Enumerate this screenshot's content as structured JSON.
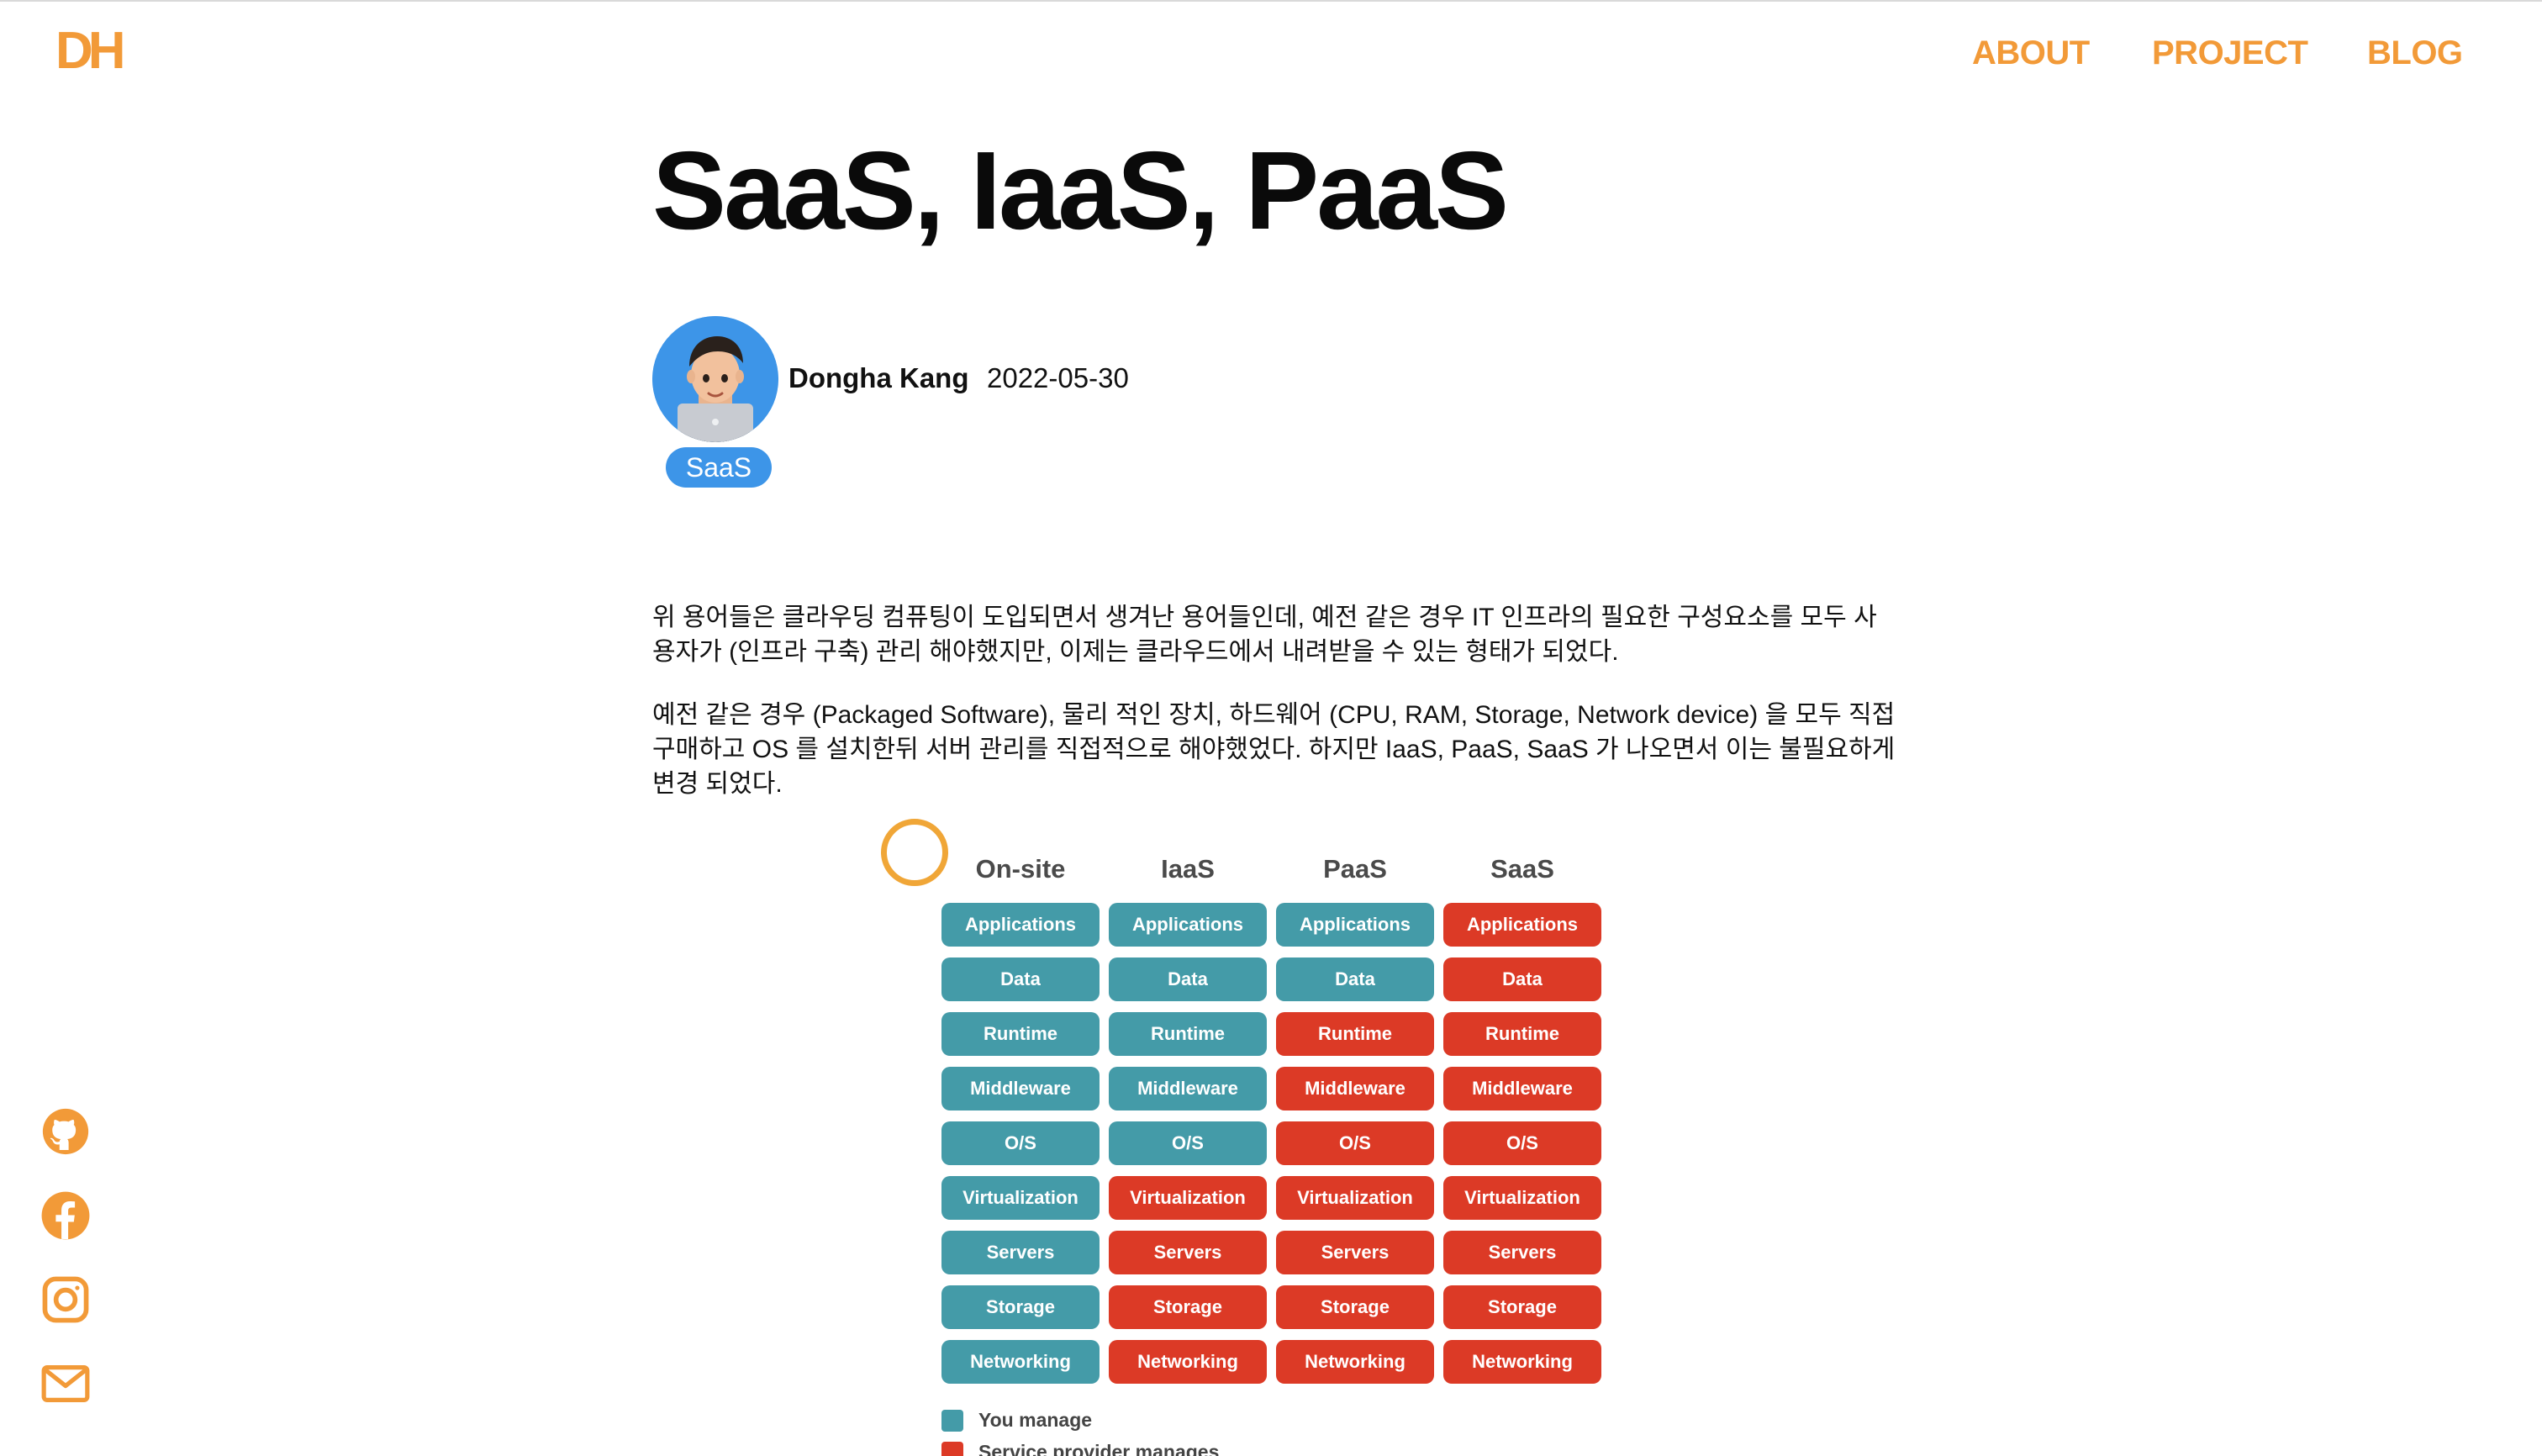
{
  "brand": {
    "logo": "DH",
    "accent": "#f29a38"
  },
  "nav": {
    "about": "ABOUT",
    "project": "PROJECT",
    "blog": "BLOG"
  },
  "social": [
    "github-icon",
    "facebook-icon",
    "instagram-icon",
    "mail-icon"
  ],
  "post": {
    "title": "SaaS, IaaS, PaaS",
    "author": "Dongha Kang",
    "date": "2022-05-30",
    "tag": "SaaS",
    "paragraph1": "위 용어들은 클라우딩 컴퓨팅이 도입되면서 생겨난 용어들인데, 예전 같은 경우 IT 인프라의 필요한 구성요소를 모두 사용자가 (인프라 구축) 관리 해야했지만, 이제는 클라우드에서 내려받을 수 있는 형태가 되었다.",
    "paragraph2": "예전 같은 경우 (Packaged Software), 물리 적인 장치, 하드웨어 (CPU, RAM, Storage, Network device) 을 모두 직접 구매하고 OS 를 설치한뒤 서버 관리를 직접적으로 해야했었다. 하지만 IaaS, PaaS, SaaS 가 나오면서 이는 불필요하게 변경 되었다."
  },
  "diagram": {
    "columns": [
      "On-site",
      "IaaS",
      "PaaS",
      "SaaS"
    ],
    "rows": [
      "Applications",
      "Data",
      "Runtime",
      "Middleware",
      "O/S",
      "Virtualization",
      "Servers",
      "Storage",
      "Networking"
    ],
    "managed_by_provider": [
      [
        false,
        false,
        false,
        false,
        false,
        false,
        false,
        false,
        false
      ],
      [
        false,
        false,
        false,
        false,
        false,
        true,
        true,
        true,
        true
      ],
      [
        false,
        false,
        true,
        true,
        true,
        true,
        true,
        true,
        true
      ],
      [
        true,
        true,
        true,
        true,
        true,
        true,
        true,
        true,
        true
      ]
    ],
    "colors": {
      "you": "#449ba8",
      "provider": "#dc3a26"
    },
    "legend": {
      "you": "You manage",
      "provider": "Service provider manages"
    }
  }
}
